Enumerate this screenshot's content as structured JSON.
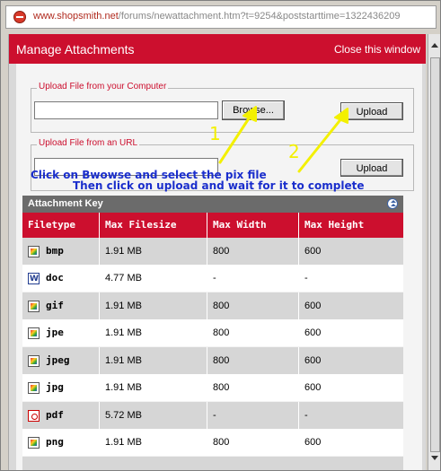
{
  "browser": {
    "url_host": "www.shopsmith.net",
    "url_rest": "/forums/newattachment.htm?t=9254&poststarttime=1322436209"
  },
  "dialog": {
    "title": "Manage Attachments",
    "close_label": "Close this window"
  },
  "upload_computer": {
    "legend": "Upload File from your Computer",
    "browse_label": "Browse...",
    "upload_label": "Upload"
  },
  "upload_url": {
    "legend": "Upload File from an URL",
    "upload_label": "Upload"
  },
  "annotations": {
    "step1_number": "1",
    "step2_number": "2",
    "line1": "Click on Bwowse and select the pix file",
    "line2": "Then click on upload and wait for it to complete",
    "color": "#1a2ecc",
    "arrow_color": "#f3f000"
  },
  "attachment_key": {
    "title": "Attachment Key",
    "columns": [
      "Filetype",
      "Max Filesize",
      "Max Width",
      "Max Height"
    ],
    "rows": [
      {
        "icon": "image-file-icon",
        "type": "bmp",
        "size": "1.91 MB",
        "width": "800",
        "height": "600"
      },
      {
        "icon": "word-doc-icon",
        "type": "doc",
        "size": "4.77 MB",
        "width": "-",
        "height": "-"
      },
      {
        "icon": "image-file-icon",
        "type": "gif",
        "size": "1.91 MB",
        "width": "800",
        "height": "600"
      },
      {
        "icon": "image-file-icon",
        "type": "jpe",
        "size": "1.91 MB",
        "width": "800",
        "height": "600"
      },
      {
        "icon": "image-file-icon",
        "type": "jpeg",
        "size": "1.91 MB",
        "width": "800",
        "height": "600"
      },
      {
        "icon": "image-file-icon",
        "type": "jpg",
        "size": "1.91 MB",
        "width": "800",
        "height": "600"
      },
      {
        "icon": "pdf-file-icon",
        "type": "pdf",
        "size": "5.72 MB",
        "width": "-",
        "height": "-"
      },
      {
        "icon": "image-file-icon",
        "type": "png",
        "size": "1.91 MB",
        "width": "800",
        "height": "600"
      }
    ]
  },
  "colors": {
    "header_red": "#cc0f2e",
    "key_bar": "#6b6b6b"
  }
}
